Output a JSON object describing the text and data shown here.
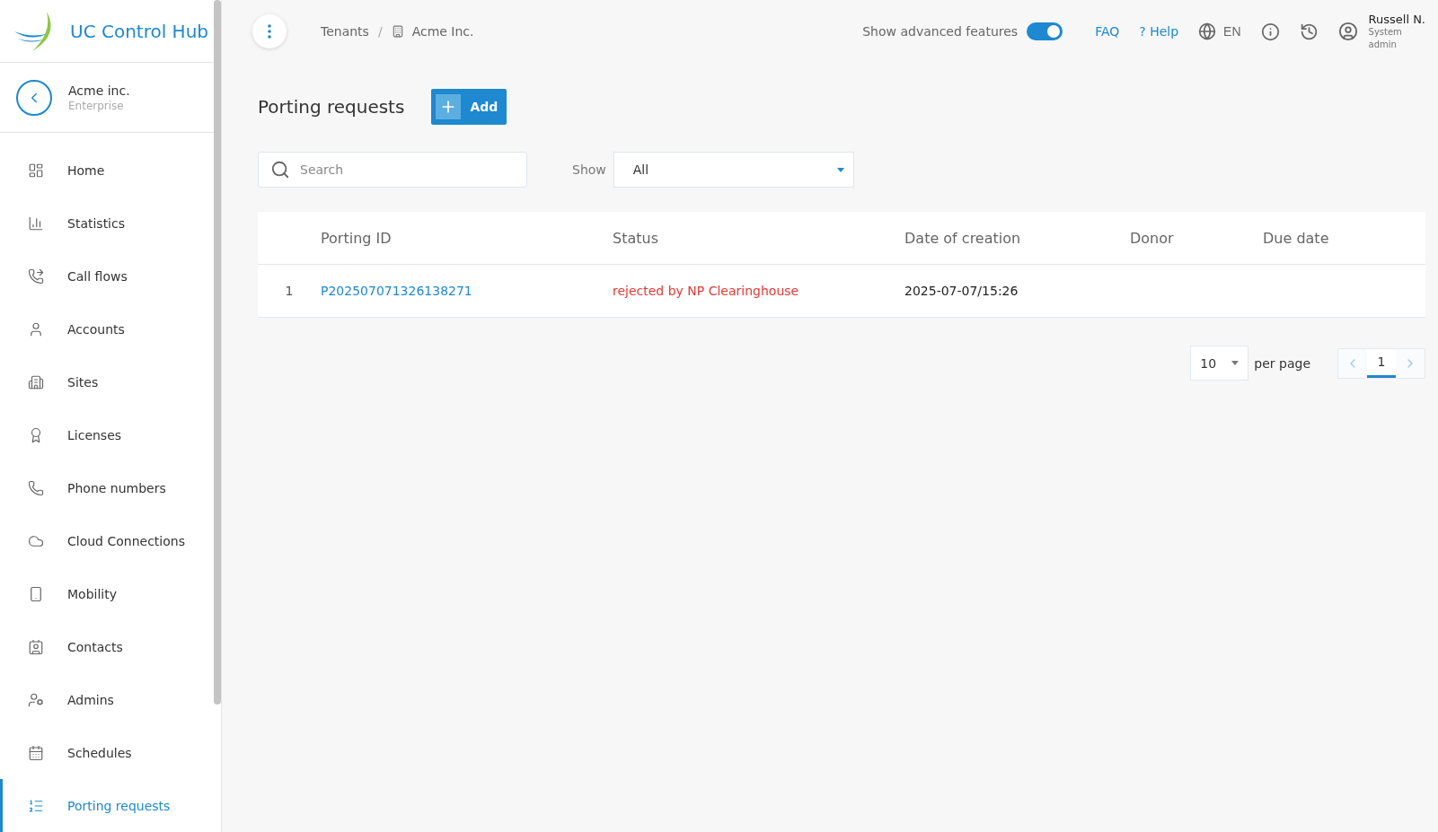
{
  "brand": {
    "name": "UC Control Hub"
  },
  "tenant": {
    "name": "Acme inc.",
    "type": "Enterprise"
  },
  "sidebar": {
    "items": [
      {
        "label": "Home",
        "kind": "home",
        "selected": false
      },
      {
        "label": "Statistics",
        "kind": "statistics",
        "selected": false
      },
      {
        "label": "Call flows",
        "kind": "callflows",
        "selected": false
      },
      {
        "label": "Accounts",
        "kind": "accounts",
        "selected": false
      },
      {
        "label": "Sites",
        "kind": "sites",
        "selected": false
      },
      {
        "label": "Licenses",
        "kind": "licenses",
        "selected": false
      },
      {
        "label": "Phone numbers",
        "kind": "phone",
        "selected": false
      },
      {
        "label": "Cloud Connections",
        "kind": "cloud",
        "selected": false
      },
      {
        "label": "Mobility",
        "kind": "mobility",
        "selected": false
      },
      {
        "label": "Contacts",
        "kind": "contacts",
        "selected": false
      },
      {
        "label": "Admins",
        "kind": "admins",
        "selected": false
      },
      {
        "label": "Schedules",
        "kind": "schedules",
        "selected": false
      },
      {
        "label": "Porting requests",
        "kind": "porting",
        "selected": true
      }
    ]
  },
  "breadcrumb": [
    "Tenants",
    "Acme Inc."
  ],
  "breadcrumb_separator": "/",
  "header": {
    "advanced_label": "Show advanced features",
    "advanced_on": true,
    "faq": "FAQ",
    "help": "Help",
    "help_mark": "?",
    "language": "EN",
    "user_name": "Russell N.",
    "user_role": "System admin"
  },
  "page": {
    "title": "Porting requests",
    "add_button": "Add"
  },
  "filters": {
    "search_placeholder": "Search",
    "show_label": "Show",
    "show_value": "All"
  },
  "table": {
    "columns": [
      "Porting ID",
      "Status",
      "Date of creation",
      "Donor",
      "Due date"
    ],
    "rows": [
      {
        "number": "1",
        "porting_id": "P202507071326138271",
        "status": "rejected by NP Clearinghouse",
        "created": "2025-07-07/15:26"
      }
    ]
  },
  "pagination": {
    "per_page_value": "10",
    "per_page_label": "per page",
    "pages": [
      {
        "label": "1",
        "selected": true
      }
    ]
  }
}
